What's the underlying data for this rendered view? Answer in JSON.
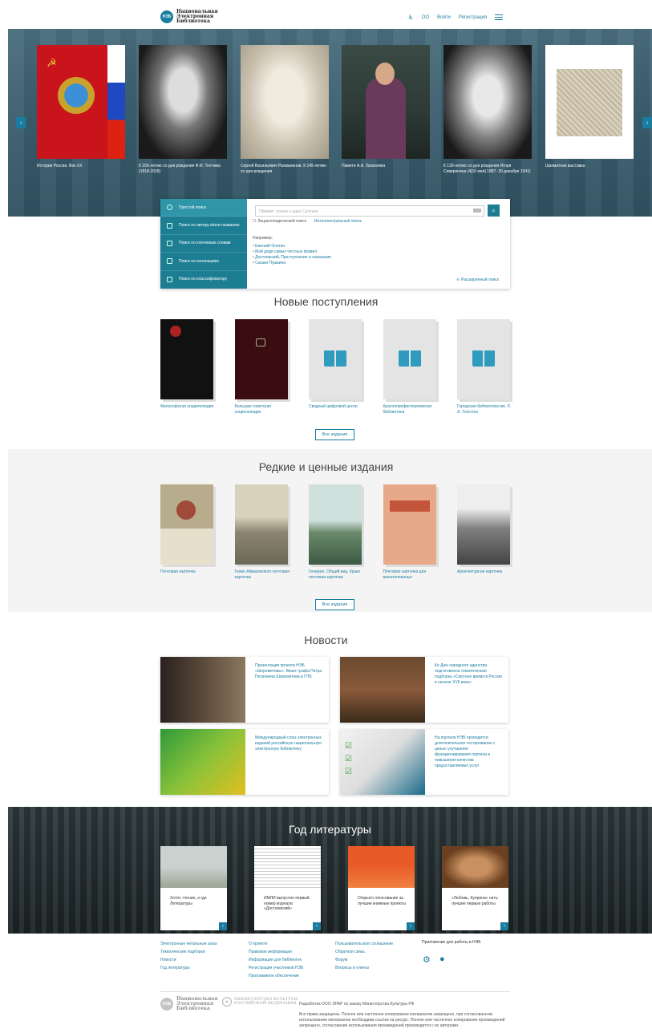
{
  "header": {
    "logo_abbr": "НЭБ",
    "logo_lines": [
      "Национальная",
      "Электронная",
      "Библиотека"
    ],
    "nav": [
      "ОО",
      "Войти",
      "Регистрация"
    ]
  },
  "hero": {
    "slides": [
      {
        "caption": "История России. Век XX"
      },
      {
        "caption": "К 200-летию со дня рождения Ф.И. Тютчева (1818-2018)"
      },
      {
        "caption": "Сергей Васильевич Рахманинов. К 145-летию со дня рождения"
      },
      {
        "caption": "Памяти А.А. Зализняка"
      },
      {
        "caption": "К 130-летию со дня рождения Игоря Северянина (4[16 мая] 1887- 20 декабря 1941)"
      },
      {
        "caption": "Шахматная выставка"
      }
    ]
  },
  "search": {
    "tabs": [
      "Простой поиск",
      "Поиск по автору и/или названию",
      "Поиск по ключевым словам",
      "Поиск по коллекциям",
      "Поиск по классификатору"
    ],
    "placeholder": "Пример: сказка о царе Салтане",
    "opt_encyclopedia": "Энциклопедический поиск",
    "opt_extended": "Интеллектуальный поиск",
    "examples_label": "Например:",
    "examples": [
      "Евгений Онегин",
      "Мой дядя самых честных правил",
      "Достоевский, Преступление и наказание",
      "Сказки Пушкина"
    ],
    "advanced": "Расширенный поиск"
  },
  "new_arrivals": {
    "title": "Новые поступления",
    "books": [
      "Философская энциклопедия",
      "Большая советская энциклопедия",
      "Сводный цифровой центр",
      "Краснопрофинтерновская библиотека",
      "Городская библиотека им. Л. А. Толстого"
    ],
    "all_button": "Все издания"
  },
  "rare": {
    "title": "Редкие и ценные издания",
    "books": [
      "Почтовая карточка",
      "Гелио Айвазовского почтовая карточка",
      "Генерал. Общий вид. Крым почтовая карточка",
      "Почтовая карточка для военнопленных",
      "Архитектурная карточка"
    ],
    "all_button": "Все издания"
  },
  "news": {
    "title": "Новости",
    "items": [
      "Презентация проекта НЭБ «Шереметевы». Визит графа Петра Петровича Шереметева в ГПБ",
      "Ко Дню народного единства подготовлена тематическая подборка «Смутное время в России в начале XVII века»",
      "Международный союз электронных изданий российскую национальную электронную библиотеку",
      "На портале НЭБ проводится дополнительное тестирование с целью улучшения функционирования портала и повышения качества предоставляемых услуг"
    ]
  },
  "literature": {
    "title": "Год литературы",
    "cards": [
      "Хотят, чтение, и где Литературы",
      "ИМЛИ выпустил первый номер журнала «Достоевский»",
      "Открыто голосование за лучшие книжные проекты",
      "«Любовь, Куприна» нить: лучшие первые работы"
    ]
  },
  "footer": {
    "col1": [
      "Электронные читальные залы",
      "Тематические подборки",
      "Новости",
      "Год литературы"
    ],
    "col2": [
      "О проекте",
      "Правовая информация",
      "Информация для библиотек",
      "Регистрация участников НЭБ",
      "Программное обеспечение"
    ],
    "col3": [
      "Пользовательское соглашение",
      "Обратная связь",
      "Форум",
      "Вопросы и ответы"
    ],
    "apps_label": "Приложение для работы в НЭБ",
    "ministry": [
      "МИНИСТЕРСТВО КУЛЬТУРЫ",
      "РОССИЙСКОЙ ФЕДЕРАЦИИ"
    ],
    "developer": "Разработка ООО ЭЛАР по заказу Министерства Культуры РФ",
    "rights": "Все права защищены. Полное или частичное копирование материалов запрещено, при согласованном использовании материалов необходима ссылка на ресурс. Полное или частичное копирование произведений запрещено, согласование использования произведений производится с их авторами."
  },
  "colors": {
    "accent": "#1a7da0",
    "panel": "#1d7e93"
  }
}
